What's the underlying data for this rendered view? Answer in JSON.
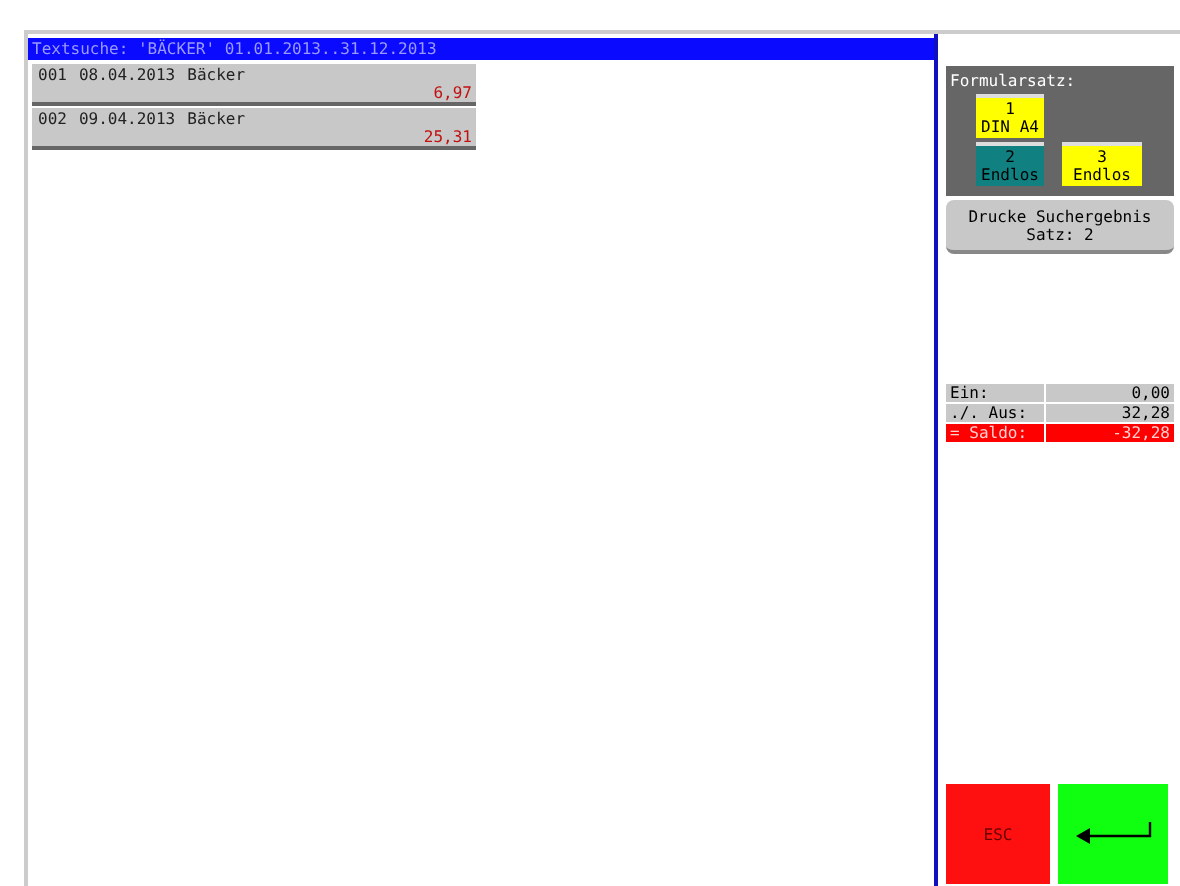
{
  "header": {
    "title": "Textsuche: 'BÄCKER'  01.01.2013..31.12.2013"
  },
  "results": [
    {
      "number": "001",
      "date": "08.04.2013",
      "text": "Bäcker",
      "amount": "6,97"
    },
    {
      "number": "002",
      "date": "09.04.2013",
      "text": "Bäcker",
      "amount": "25,31"
    }
  ],
  "form_set": {
    "title": "Formularsatz:",
    "options": [
      {
        "number": "1",
        "label": "DIN A4",
        "selected": false
      },
      {
        "number": "2",
        "label": "Endlos",
        "selected": true
      },
      {
        "number": "3",
        "label": "Endlos",
        "selected": false
      }
    ]
  },
  "print_button": {
    "line_1": "Drucke Suchergebnis",
    "line_2": "Satz: 2"
  },
  "totals": [
    {
      "label": "Ein:",
      "value": "0,00",
      "kind": "normal"
    },
    {
      "label": "./. Aus:",
      "value": "32,28",
      "kind": "normal"
    },
    {
      "label": "= Saldo:",
      "value": "-32,28",
      "kind": "alert"
    }
  ],
  "buttons": {
    "escape": "ESC"
  }
}
